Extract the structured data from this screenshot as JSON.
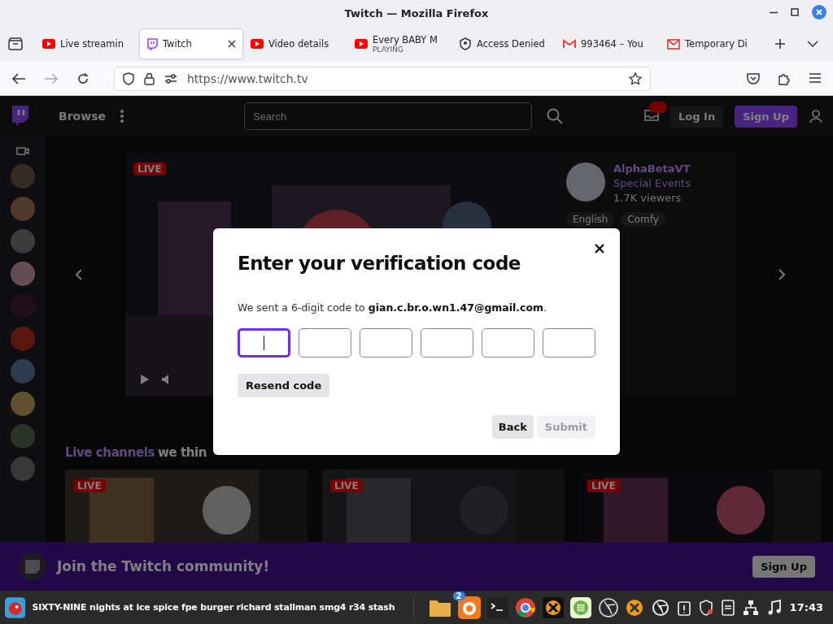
{
  "window": {
    "title": "Twitch — Mozilla Firefox"
  },
  "tabs": [
    {
      "label": "Live streamin",
      "selected": false
    },
    {
      "label": "Twitch",
      "selected": true
    },
    {
      "label": "Video details",
      "selected": false
    },
    {
      "label": "Every BABY M",
      "selected": false,
      "status": "PLAYING"
    },
    {
      "label": "Access Denied",
      "selected": false
    },
    {
      "label": "993464 – You",
      "selected": false
    },
    {
      "label": "Temporary Di",
      "selected": false
    }
  ],
  "address_bar": {
    "url": "https://www.twitch.tv"
  },
  "site": {
    "nav": {
      "browse": "Browse",
      "search_placeholder": "Search",
      "login": "Log In",
      "signup": "Sign Up"
    },
    "featured": {
      "live_tag": "LIVE",
      "channel": "AlphaBetaVT",
      "category": "Special Events",
      "viewers": "1.7K viewers",
      "tags": [
        "English",
        "Comfy"
      ]
    },
    "section_heading": {
      "highlight": "Live channels",
      "rest": "we thin"
    },
    "cards": [
      {
        "live_tag": "LIVE"
      },
      {
        "live_tag": "LIVE"
      },
      {
        "live_tag": "LIVE"
      }
    ],
    "banner": {
      "text": "Join the Twitch community!",
      "button": "Sign Up"
    }
  },
  "dialog": {
    "title": "Enter your verification code",
    "message": "We sent a 6-digit code to **gian.c.br.o.wn1.47@gmail.com**.",
    "code_boxes": [
      {
        "focused": true
      },
      {
        "focused": false
      },
      {
        "focused": false
      },
      {
        "focused": false
      },
      {
        "focused": false
      },
      {
        "focused": false
      }
    ],
    "resend": "Resend code",
    "back": "Back",
    "submit": {
      "label": "Submit",
      "disabled": true
    }
  },
  "taskbar": {
    "window_title": "SIXTY-NINE nights at ice spice fpe burger richard stallman smg4 r34 stash",
    "firefox_badge": "2",
    "clock": "17:43"
  }
}
